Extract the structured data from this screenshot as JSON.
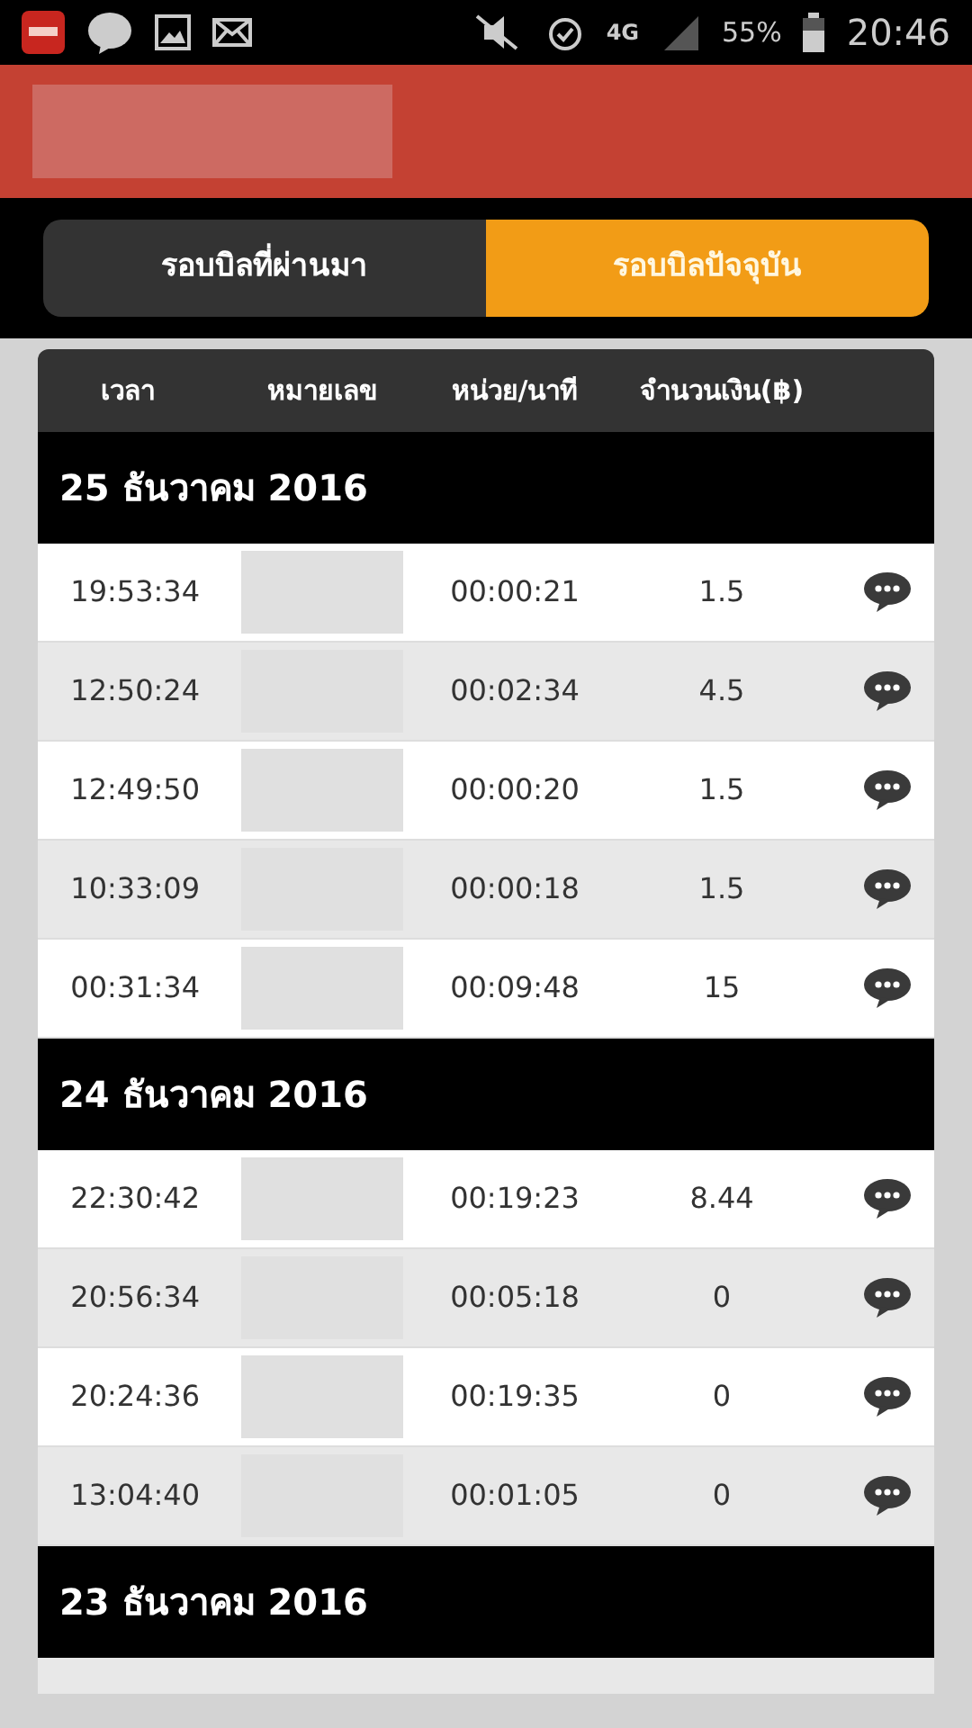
{
  "status_bar": {
    "network": "4G",
    "battery": "55%",
    "time": "20:46"
  },
  "tabs": [
    {
      "label": "รอบบิลที่ผ่านมา",
      "selected": false
    },
    {
      "label": "รอบบิลปัจจุบัน",
      "selected": true
    }
  ],
  "table": {
    "columns": [
      "เวลา",
      "หมายเลข",
      "หน่วย/นาที",
      "จำนวนเงิน(฿)"
    ],
    "groups": [
      {
        "date": "25 ธันวาคม 2016",
        "rows": [
          {
            "time": "19:53:34",
            "duration": "00:00:21",
            "amount": "1.5"
          },
          {
            "time": "12:50:24",
            "duration": "00:02:34",
            "amount": "4.5"
          },
          {
            "time": "12:49:50",
            "duration": "00:00:20",
            "amount": "1.5"
          },
          {
            "time": "10:33:09",
            "duration": "00:00:18",
            "amount": "1.5"
          },
          {
            "time": "00:31:34",
            "duration": "00:09:48",
            "amount": "15"
          }
        ]
      },
      {
        "date": "24 ธันวาคม 2016",
        "rows": [
          {
            "time": "22:30:42",
            "duration": "00:19:23",
            "amount": "8.44"
          },
          {
            "time": "20:56:34",
            "duration": "00:05:18",
            "amount": "0"
          },
          {
            "time": "20:24:36",
            "duration": "00:19:35",
            "amount": "0"
          },
          {
            "time": "13:04:40",
            "duration": "00:01:05",
            "amount": "0"
          }
        ]
      },
      {
        "date": "23 ธันวาคม 2016"
      }
    ]
  }
}
